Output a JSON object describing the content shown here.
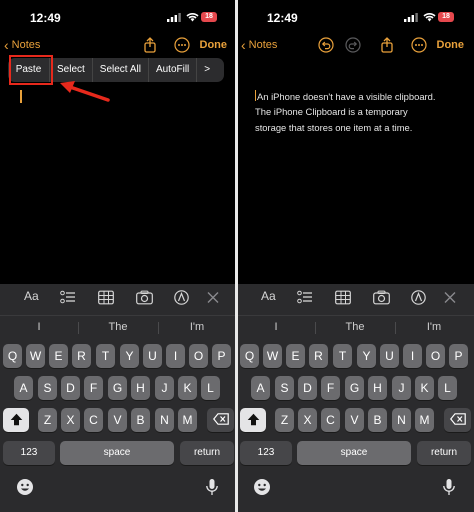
{
  "status": {
    "time": "12:49",
    "battery": "18"
  },
  "left": {
    "nav": {
      "back_label": "Notes",
      "done_label": "Done"
    },
    "context_menu": {
      "items": [
        "Paste",
        "Select",
        "Select All",
        "AutoFill",
        ">"
      ]
    }
  },
  "right": {
    "nav": {
      "back_label": "Notes",
      "done_label": "Done"
    },
    "note_lines": [
      "An iPhone doesn't have a visible clipboard.",
      "The iPhone Clipboard is a temporary",
      "storage that stores one item at a time."
    ]
  },
  "keyboard": {
    "toolbar": {
      "format": "Aa"
    },
    "predictions": [
      "I",
      "The",
      "I'm"
    ],
    "rows": [
      [
        "Q",
        "W",
        "E",
        "R",
        "T",
        "Y",
        "U",
        "I",
        "O",
        "P"
      ],
      [
        "A",
        "S",
        "D",
        "F",
        "G",
        "H",
        "J",
        "K",
        "L"
      ],
      [
        "Z",
        "X",
        "C",
        "V",
        "B",
        "N",
        "M"
      ]
    ],
    "numbers_label": "123",
    "space_label": "space",
    "return_label": "return"
  },
  "colors": {
    "accent": "#e9a13b",
    "highlight": "#e7291c"
  }
}
